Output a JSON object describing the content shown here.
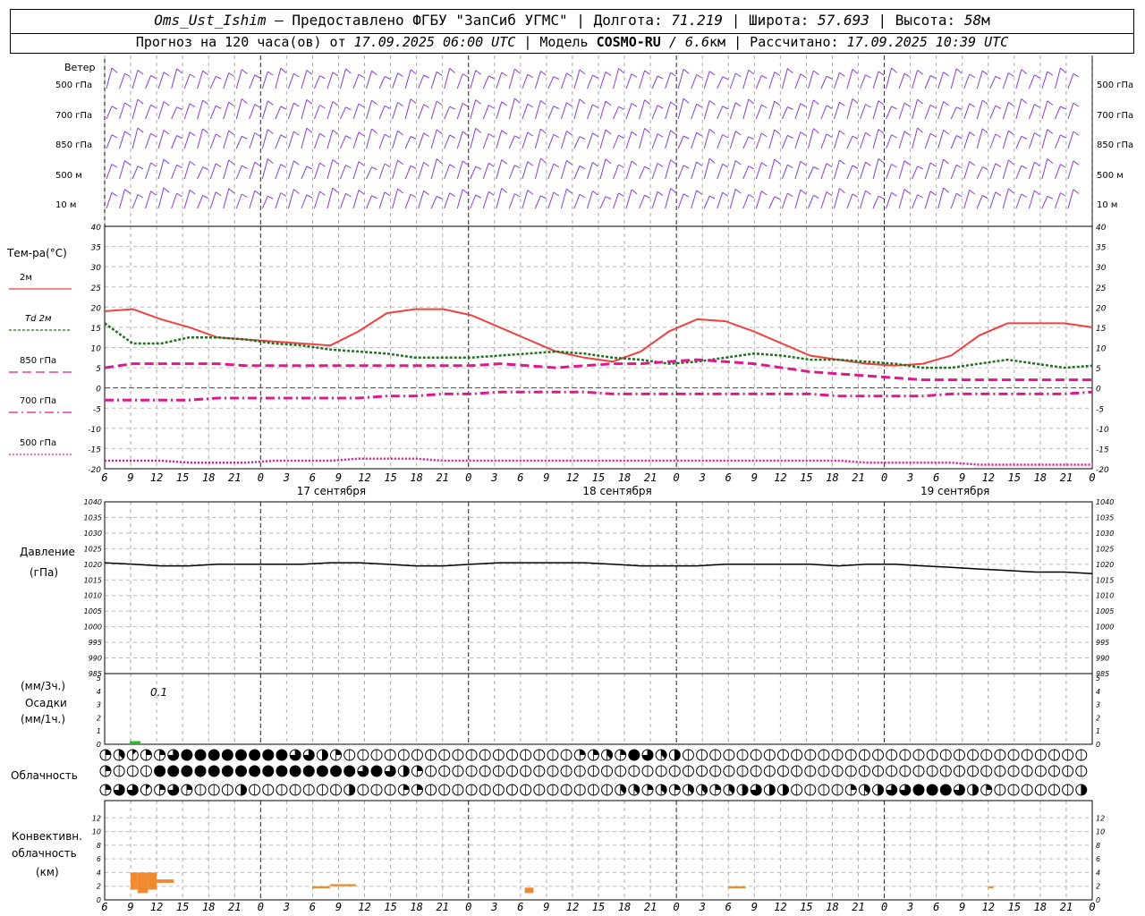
{
  "header": {
    "station": "Oms_Ust_Ishim",
    "provider": "– Предоставлено ФГБУ \"ЗапСиб УГМС\" |",
    "lon_label": "Долгота:",
    "lon": "71.219",
    "lat_label": "| Широта:",
    "lat": "57.693",
    "alt_label": "| Высота:",
    "alt": "58",
    "alt_unit": "м",
    "forecast_prefix": "Прогноз на 120 часа(ов) от",
    "forecast_time": "17.09.2025 06:00 UTC",
    "model_label": "| Модель",
    "model": "COSMO-RU",
    "resolution": "/ 6.6",
    "resolution_unit": "км",
    "computed_label": "| Рассчитано:",
    "computed": "17.09.2025 10:39 UTC"
  },
  "chart_data": {
    "type": "line",
    "x_hours": [
      6,
      9,
      12,
      15,
      18,
      21,
      0,
      3,
      6,
      9,
      12,
      15,
      18,
      21,
      0,
      3,
      6,
      9,
      12,
      15,
      18,
      21,
      0,
      3,
      6,
      9,
      12
    ],
    "dates": [
      "17 сентября",
      "18 сентября",
      "19 сентября"
    ],
    "wind": {
      "title": "Ветер",
      "levels": [
        "500 гПа",
        "700 гПа",
        "850 гПа",
        "500 м",
        "10  м"
      ]
    },
    "temperature": {
      "title": "Тем-ра(°C)",
      "ylim": [
        -20,
        40
      ],
      "yticks": [
        40,
        35,
        30,
        25,
        20,
        15,
        10,
        5,
        0,
        -5,
        -10,
        -15,
        -20
      ],
      "series": [
        {
          "name": "2м",
          "color": "#f04040",
          "style": "solid",
          "values": [
            19,
            19.5,
            17,
            15,
            12.5,
            12,
            11.5,
            11,
            10.5,
            14,
            18.5,
            19.5,
            19.5,
            18,
            15,
            12,
            9,
            7.5,
            6.5,
            9,
            14,
            17,
            16.5,
            14,
            11,
            8,
            7,
            6,
            5.5,
            6,
            8,
            13,
            16,
            16,
            16,
            15
          ]
        },
        {
          "name": "Td 2м",
          "color": "#207020",
          "style": "dotted",
          "values": [
            16,
            11,
            11,
            12.5,
            12.5,
            12,
            11,
            10.5,
            9.5,
            9,
            8.5,
            7.5,
            7.5,
            7.5,
            8,
            8.5,
            9,
            8.5,
            7.5,
            7,
            6,
            6.5,
            7.5,
            8.5,
            8,
            7,
            7,
            6.5,
            6,
            5,
            5,
            6,
            7,
            6,
            5,
            5.5
          ]
        },
        {
          "name": "850 гПа",
          "color": "#e01890",
          "style": "dashed",
          "values": [
            5,
            6,
            6,
            6,
            6,
            5.5,
            5.5,
            5.5,
            5.5,
            5.5,
            5.5,
            5.5,
            5.5,
            5.5,
            6,
            5.5,
            5,
            5.5,
            6,
            6,
            6.5,
            7,
            6.5,
            6,
            5,
            4,
            3.5,
            3,
            2.5,
            2,
            2,
            2,
            2,
            2,
            2,
            2
          ]
        },
        {
          "name": "700 гПа",
          "color": "#e01890",
          "style": "dashdot",
          "values": [
            -3,
            -3,
            -3,
            -3,
            -2.5,
            -2.5,
            -2.5,
            -2.5,
            -2.5,
            -2.5,
            -2,
            -2,
            -1.5,
            -1.5,
            -1,
            -1,
            -1,
            -1,
            -1.5,
            -1.5,
            -1.5,
            -1.5,
            -1.5,
            -1.5,
            -1.5,
            -1.5,
            -2,
            -2,
            -2,
            -2,
            -1.5,
            -1.5,
            -1.5,
            -1.5,
            -1.5,
            -1
          ]
        },
        {
          "name": "500 гПа",
          "color": "#e01890",
          "style": "fine",
          "values": [
            -18,
            -18,
            -18,
            -18.5,
            -18.5,
            -18.5,
            -18,
            -18,
            -18,
            -17.5,
            -17.5,
            -17.5,
            -18,
            -18,
            -18,
            -18,
            -18,
            -18,
            -18,
            -18,
            -18,
            -18,
            -18,
            -18,
            -18,
            -18,
            -18,
            -18.5,
            -18.5,
            -18.5,
            -18.5,
            -19,
            -19,
            -19,
            -19,
            -19
          ]
        }
      ]
    },
    "pressure": {
      "title": "Давление",
      "unit": "(гПа)",
      "ylim": [
        985,
        1040
      ],
      "yticks": [
        1040,
        1035,
        1030,
        1025,
        1020,
        1015,
        1010,
        1005,
        1000,
        995,
        990,
        985
      ],
      "values": [
        1020.5,
        1020,
        1019.5,
        1019.5,
        1020,
        1020,
        1020,
        1020,
        1020.5,
        1020.5,
        1020,
        1019.5,
        1019.5,
        1020,
        1020.5,
        1020.5,
        1020.5,
        1020.5,
        1020,
        1019.5,
        1019.5,
        1019.5,
        1020,
        1020,
        1020,
        1020,
        1019.5,
        1020,
        1020,
        1019.5,
        1019,
        1018.5,
        1018,
        1017.5,
        1017.5,
        1017
      ]
    },
    "precip": {
      "title": "Осадки",
      "unit_top": "(мм/3ч.)",
      "unit_bottom": "(мм/1ч.)",
      "ylim": [
        0,
        5
      ],
      "yticks": [
        5,
        4,
        3,
        2,
        1,
        0
      ],
      "annotation": "0.1",
      "bars": [
        {
          "x_hours": 9.5,
          "value": 0.1
        }
      ]
    },
    "clouds": {
      "title": "Облачность",
      "rows": [
        [
          2,
          3,
          1,
          2,
          2,
          6,
          8,
          8,
          8,
          8,
          8,
          8,
          8,
          8,
          6,
          6,
          4,
          2,
          0,
          0,
          0,
          0,
          0,
          0,
          0,
          0,
          0,
          0,
          0,
          0,
          0,
          0,
          0,
          0,
          0,
          2,
          2,
          3,
          2,
          8,
          6,
          3,
          4,
          0,
          0,
          0,
          0,
          0,
          0,
          0,
          0,
          0,
          0,
          0,
          0,
          0,
          0,
          0,
          0,
          0,
          0,
          0,
          0,
          0,
          0,
          0,
          0,
          0,
          0,
          0,
          0,
          0,
          0,
          0,
          0,
          0,
          0,
          0,
          0,
          0,
          0,
          0,
          0,
          0,
          0,
          0,
          2,
          1,
          0,
          0,
          0,
          0,
          0,
          0,
          0,
          0,
          0,
          0,
          3,
          4,
          2,
          1,
          6,
          6,
          3,
          2,
          2,
          1,
          2,
          2,
          3,
          2,
          1,
          0,
          0,
          0,
          0,
          0,
          0,
          0,
          0,
          0
        ],
        [
          2,
          0,
          0,
          0,
          8,
          8,
          8,
          8,
          8,
          8,
          8,
          8,
          8,
          8,
          8,
          8,
          8,
          8,
          8,
          6,
          8,
          6,
          4,
          2,
          0,
          0,
          0,
          0,
          0,
          0,
          0,
          0,
          0,
          0,
          0,
          0,
          0,
          0,
          0,
          0,
          0,
          0,
          0,
          0,
          0,
          0,
          0,
          0,
          0,
          0,
          0,
          0,
          0,
          0,
          0,
          0,
          0,
          0,
          0,
          0,
          0,
          0,
          0,
          0,
          0,
          0,
          0,
          0,
          0,
          0,
          0,
          0,
          0,
          0,
          0,
          0,
          0,
          0,
          0,
          0,
          0,
          0,
          0,
          0,
          0,
          0,
          0,
          0,
          0,
          0,
          0,
          0,
          0,
          0,
          0,
          0,
          0,
          0,
          0,
          0,
          0,
          0,
          0,
          0,
          0,
          0,
          0,
          0,
          0,
          0,
          0,
          0,
          0,
          0,
          0,
          0,
          0,
          0,
          0,
          0,
          0,
          0
        ],
        [
          2,
          6,
          6,
          1,
          2,
          6,
          2,
          0,
          0,
          0,
          4,
          0,
          0,
          0,
          0,
          0,
          0,
          0,
          4,
          0,
          0,
          0,
          2,
          2,
          0,
          0,
          0,
          0,
          0,
          0,
          0,
          0,
          0,
          0,
          0,
          0,
          0,
          0,
          3,
          3,
          2,
          3,
          2,
          3,
          3,
          2,
          3,
          4,
          6,
          4,
          4,
          0,
          0,
          0,
          0,
          2,
          3,
          4,
          6,
          6,
          8,
          8,
          8,
          6,
          4,
          2,
          0,
          0,
          0,
          0,
          0,
          0,
          4,
          6,
          2,
          4,
          2,
          0,
          0,
          0,
          0,
          0,
          0,
          0,
          0,
          0,
          0,
          0,
          0,
          0,
          0,
          0,
          0,
          0,
          0,
          0,
          0,
          0,
          4,
          6,
          6,
          8,
          4,
          4,
          2,
          0,
          0,
          3,
          6,
          8,
          6,
          8,
          8,
          6,
          6,
          6,
          2,
          0,
          2,
          4,
          6,
          0
        ]
      ]
    },
    "convective": {
      "title_l1": "Конвективн.",
      "title_l2": "облачность",
      "unit": "(км)",
      "ylim": [
        0,
        14
      ],
      "yticks": [
        12,
        10,
        8,
        6,
        4,
        2,
        0
      ],
      "color": "#f08a30",
      "blocks": [
        {
          "x0": 9,
          "x1": 9.8,
          "base": 1.5,
          "top": 4
        },
        {
          "x0": 9.8,
          "x1": 11,
          "base": 1,
          "top": 4
        },
        {
          "x0": 11,
          "x1": 12,
          "base": 1.5,
          "top": 4
        },
        {
          "x0": 12,
          "x1": 14,
          "base": 2.5,
          "top": 3
        },
        {
          "x0": 30,
          "x1": 32,
          "base": 1.7,
          "top": 2
        },
        {
          "x0": 32,
          "x1": 35,
          "base": 2,
          "top": 2.3
        },
        {
          "x0": 54.5,
          "x1": 55.5,
          "base": 1,
          "top": 1.8
        },
        {
          "x0": 78,
          "x1": 80,
          "base": 1.7,
          "top": 2
        },
        {
          "x0": 108,
          "x1": 108.6,
          "base": 1.7,
          "top": 2
        }
      ]
    }
  }
}
